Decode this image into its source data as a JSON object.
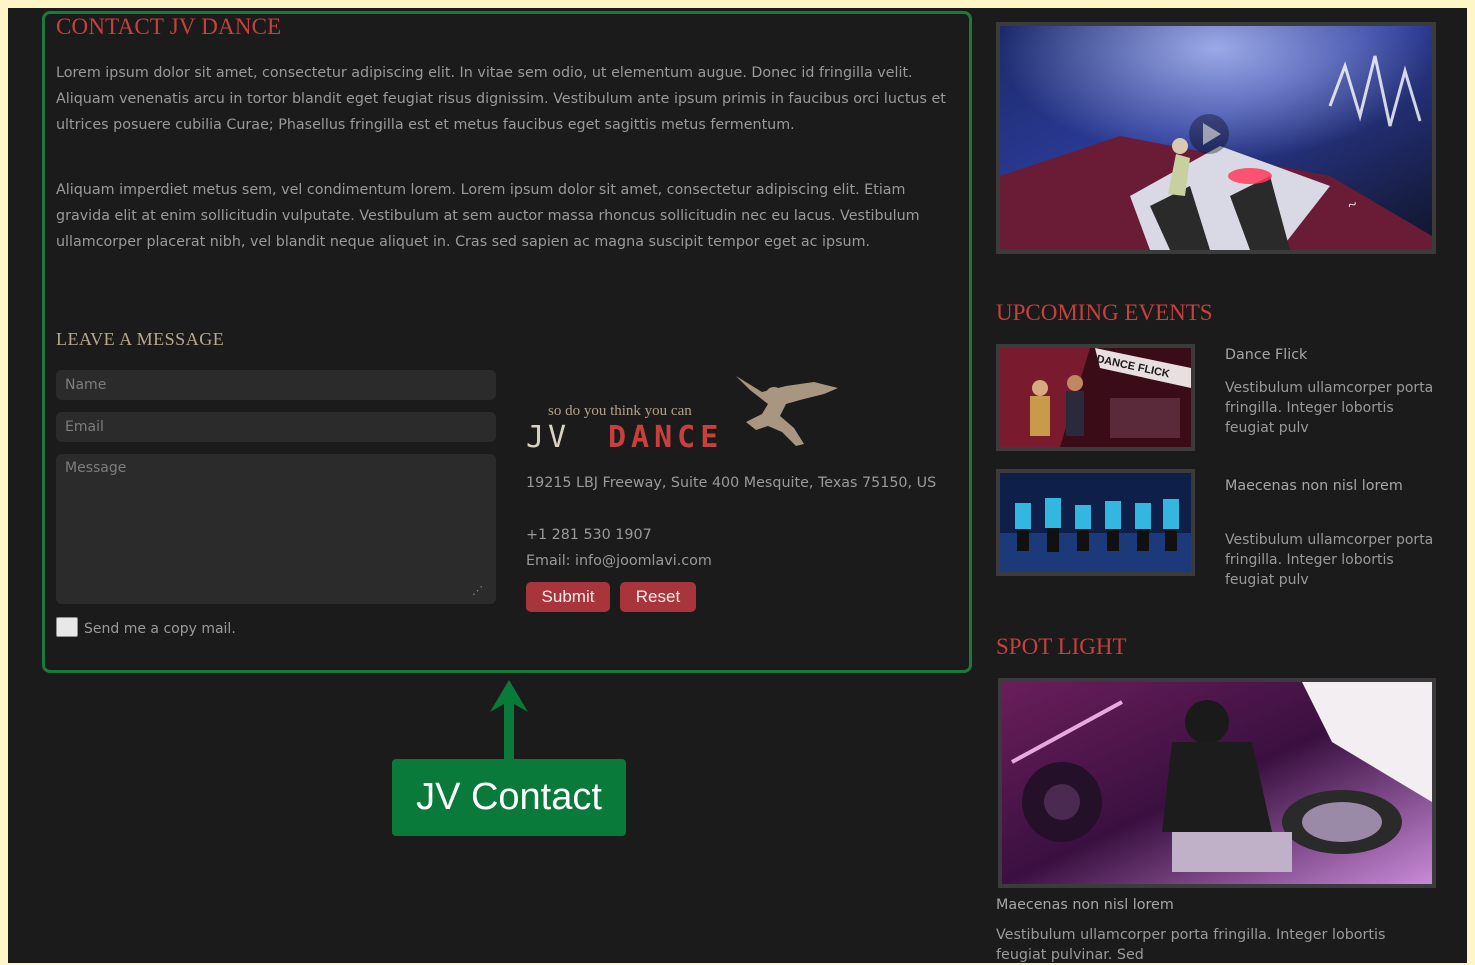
{
  "contact": {
    "title": "CONTACT JV DANCE",
    "paragraph1": "Lorem ipsum dolor sit amet, consectetur adipiscing elit. In vitae sem odio, ut elementum augue. Donec id fringilla velit. Aliquam venenatis arcu in tortor blandit eget feugiat risus dignissim. Vestibulum ante ipsum primis in faucibus orci luctus et ultrices posuere cubilia Curae; Phasellus fringilla est et metus faucibus eget sagittis metus fermentum.",
    "paragraph2": "Aliquam imperdiet metus sem, vel condimentum lorem. Lorem ipsum dolor sit amet, consectetur adipiscing elit. Etiam gravida elit at enim sollicitudin vulputate. Vestibulum at sem auctor massa rhoncus sollicitudin nec eu lacus. Vestibulum ullamcorper placerat nibh, vel blandit neque aliquet in. Cras sed sapien ac magna suscipit tempor eget ac ipsum."
  },
  "form": {
    "title": "LEAVE A MESSAGE",
    "name_placeholder": "Name",
    "email_placeholder": "Email",
    "message_placeholder": "Message",
    "copy_label": "Send me a copy mail.",
    "submit_label": "Submit",
    "reset_label": "Reset"
  },
  "logo": {
    "tagline": "so do you think you can",
    "jv": "JV",
    "dance": "DANCE"
  },
  "address": {
    "line1": "19215 LBJ Freeway, Suite 400 Mesquite, Texas 75150, US",
    "phone": "+1 281 530 1907",
    "email": "Email: info@joomlavi.com"
  },
  "annotation": {
    "label": "JV Contact",
    "color": "#0a7a3a"
  },
  "sidebar": {
    "events_title": "UPCOMING EVENTS",
    "events": [
      {
        "title": "Dance Flick",
        "text": "Vestibulum ullamcorper porta fringilla. Integer lobortis feugiat pulv"
      },
      {
        "title": "Maecenas non nisl lorem",
        "text": "Vestibulum ullamcorper porta fringilla. Integer lobortis feugiat pulv"
      }
    ],
    "spotlight_title": "SPOT LIGHT",
    "spotlight": {
      "title": "Maecenas non nisl lorem",
      "text": "Vestibulum ullamcorper porta fringilla. Integer lobortis feugiat pulvinar. Sed"
    }
  },
  "colors": {
    "background": "#1b1b1b",
    "page": "#fff6c8",
    "accent_red": "#c8403c",
    "border_green": "#1a7a3c",
    "button_red": "#a8353b"
  }
}
